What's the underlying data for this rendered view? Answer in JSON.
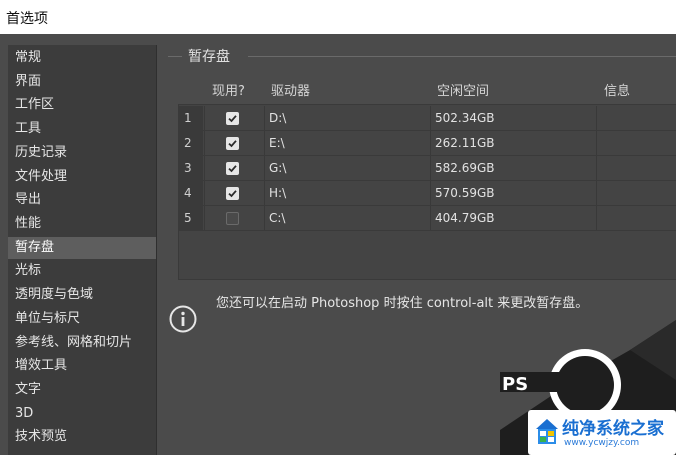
{
  "window": {
    "title": "首选项"
  },
  "sidebar": {
    "items": [
      {
        "label": "常规"
      },
      {
        "label": "界面"
      },
      {
        "label": "工作区"
      },
      {
        "label": "工具"
      },
      {
        "label": "历史记录"
      },
      {
        "label": "文件处理"
      },
      {
        "label": "导出"
      },
      {
        "label": "性能"
      },
      {
        "label": "暂存盘",
        "selected": true
      },
      {
        "label": "光标"
      },
      {
        "label": "透明度与色域"
      },
      {
        "label": "单位与标尺"
      },
      {
        "label": "参考线、网格和切片"
      },
      {
        "label": "增效工具"
      },
      {
        "label": "文字"
      },
      {
        "label": "3D"
      },
      {
        "label": "技术预览"
      }
    ]
  },
  "scratch": {
    "group_title": "暂存盘",
    "headers": {
      "active": "现用?",
      "drive": "驱动器",
      "free": "空闲空间",
      "info": "信息"
    },
    "rows": [
      {
        "index": "1",
        "active": true,
        "drive": "D:\\",
        "free": "502.34GB",
        "info": ""
      },
      {
        "index": "2",
        "active": true,
        "drive": "E:\\",
        "free": "262.11GB",
        "info": ""
      },
      {
        "index": "3",
        "active": true,
        "drive": "G:\\",
        "free": "582.69GB",
        "info": ""
      },
      {
        "index": "4",
        "active": true,
        "drive": "H:\\",
        "free": "570.59GB",
        "info": ""
      },
      {
        "index": "5",
        "active": false,
        "drive": "C:\\",
        "free": "404.79GB",
        "info": ""
      }
    ]
  },
  "info": {
    "text": "您还可以在启动 Photoshop 时按住 control-alt 来更改暂存盘。"
  },
  "watermark": {
    "title": "纯净系统之家",
    "url": "www.ycwjzy.com"
  }
}
